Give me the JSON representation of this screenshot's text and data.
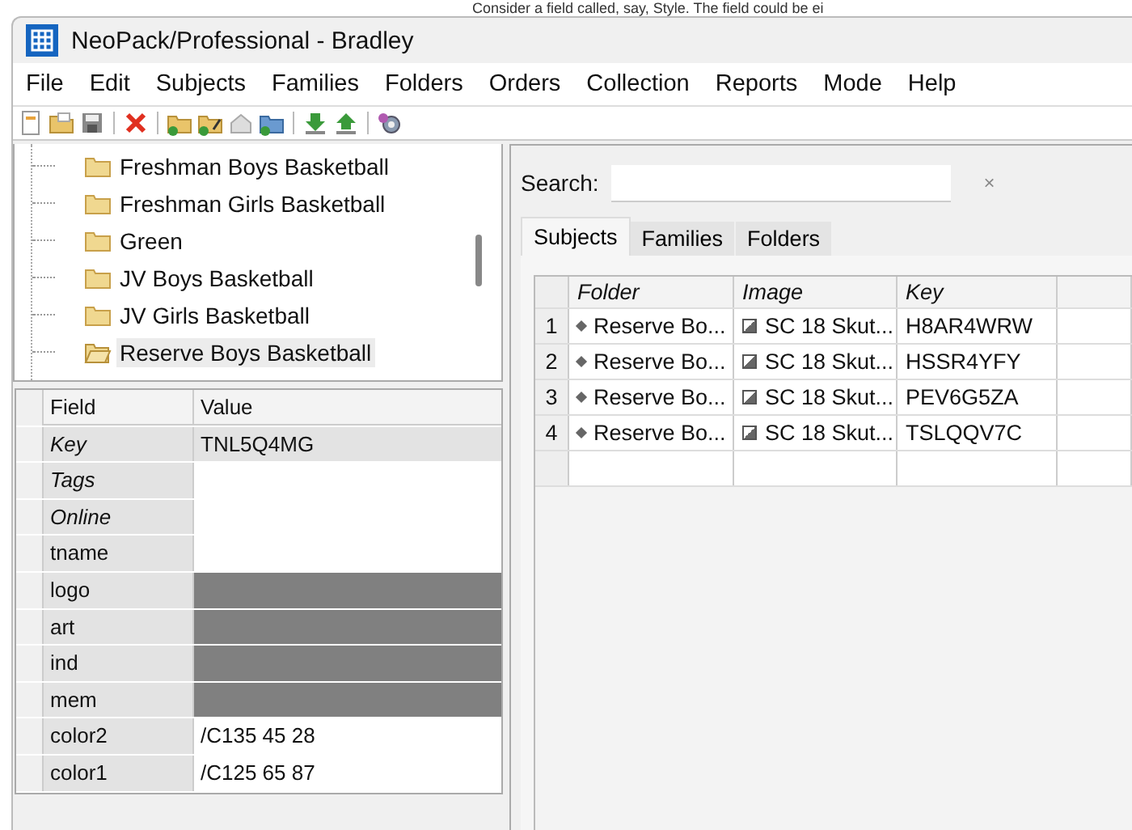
{
  "background_text": "Consider a field called, say, Style. The field could be ei",
  "window": {
    "title": "NeoPack/Professional - Bradley"
  },
  "menu": [
    "File",
    "Edit",
    "Subjects",
    "Families",
    "Folders",
    "Orders",
    "Collection",
    "Reports",
    "Mode",
    "Help"
  ],
  "tree": {
    "items": [
      {
        "label": "Freshman Boys Basketball",
        "selected": false
      },
      {
        "label": "Freshman Girls Basketball",
        "selected": false
      },
      {
        "label": "Green",
        "selected": false
      },
      {
        "label": "JV Boys Basketball",
        "selected": false
      },
      {
        "label": "JV Girls Basketball",
        "selected": false
      },
      {
        "label": "Reserve Boys Basketball",
        "selected": true
      }
    ]
  },
  "properties": {
    "columns": [
      "Field",
      "Value"
    ],
    "rows": [
      {
        "field": "Key",
        "value": "TNL5Q4MG",
        "builtin": true,
        "kind": "text",
        "selected": true
      },
      {
        "field": "Tags",
        "builtin": true,
        "kind": "text",
        "selected": false
      },
      {
        "field": "Online",
        "builtin": true,
        "kind": "text",
        "selected": false
      },
      {
        "field": "tname",
        "builtin": false,
        "kind": "text",
        "selected": false
      },
      {
        "field": "logo",
        "builtin": false,
        "kind": "binary",
        "selected": false
      },
      {
        "field": "art",
        "builtin": false,
        "kind": "binary",
        "selected": false
      },
      {
        "field": "ind",
        "builtin": false,
        "kind": "binary",
        "selected": false
      },
      {
        "field": "mem",
        "builtin": false,
        "kind": "binary",
        "selected": false
      },
      {
        "field": "color2",
        "value": "/C135 45 28",
        "builtin": false,
        "kind": "text",
        "selected": false
      },
      {
        "field": "color1",
        "value": "/C125 65 87",
        "builtin": false,
        "kind": "text",
        "selected": false
      }
    ]
  },
  "search": {
    "label": "Search:",
    "clear": "×"
  },
  "tabs": [
    {
      "label": "Subjects",
      "selected": true
    },
    {
      "label": "Families",
      "selected": false
    },
    {
      "label": "Folders",
      "selected": false
    }
  ],
  "table": {
    "columns": [
      "Folder",
      "Image",
      "Key"
    ],
    "rows": [
      {
        "number": "1",
        "folder": "Reserve Bo...",
        "image": "SC 18 Skut...",
        "key": "H8AR4WRW"
      },
      {
        "number": "2",
        "folder": "Reserve Bo...",
        "image": "SC 18 Skut...",
        "key": "HSSR4YFY"
      },
      {
        "number": "3",
        "folder": "Reserve Bo...",
        "image": "SC 18 Skut...",
        "key": "PEV6G5ZA"
      },
      {
        "number": "4",
        "folder": "Reserve Bo...",
        "image": "SC 18 Skut...",
        "key": "TSLQQV7C"
      }
    ]
  }
}
